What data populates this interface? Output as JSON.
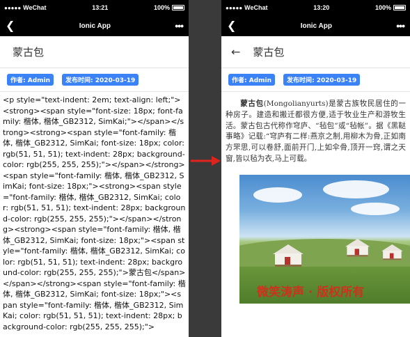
{
  "status": {
    "carrier": "WeChat",
    "battery": "100%",
    "time_left": "13:21",
    "time_right": "13:20"
  },
  "nav": {
    "title": "Ionic App",
    "more": "•••"
  },
  "header": {
    "title": "蒙古包"
  },
  "meta": {
    "author": "作者: Admin",
    "date": "发布时间: 2020-03-19"
  },
  "raw_html": "<p style=\"text-indent: 2em; text-align: left;\"><strong><span style=\"font-size: 18px; font-family: 楷体, 楷体_GB2312, SimKai;\"></span></strong><strong><span style=\"font-family: 楷体, 楷体_GB2312, SimKai; font-size: 18px; color: rgb(51, 51, 51); text-indent: 28px; background-color: rgb(255, 255, 255);\"></span></strong><span style=\"font-family: 楷体, 楷体_GB2312, SimKai; font-size: 18px;\"><strong><span style=\"font-family: 楷体, 楷体_GB2312, SimKai; color: rgb(51, 51, 51); text-indent: 28px; background-color: rgb(255, 255, 255);\"></span></strong><strong><span style=\"font-family: 楷体, 楷体_GB2312, SimKai; font-size: 18px;\"><span style=\"font-family: 楷体, 楷体_GB2312, SimKai; color: rgb(51, 51, 51); text-indent: 28px; background-color: rgb(255, 255, 255);\">蒙古包</span></span></strong><span style=\"font-family: 楷体, 楷体_GB2312, SimKai; font-size: 18px;\"><span style=\"font-family: 楷体, 楷体_GB2312, SimKai; color: rgb(51, 51, 51); text-indent: 28px; background-color: rgb(255, 255, 255);\">",
  "article": {
    "bold": "蒙古包",
    "body": "(Mongolianyurts)是蒙古族牧民居住的一种房子。建造和搬迁都很方便,适于牧业生产和游牧生活。蒙古包古代称作穹庐、“毡包”或“毡帐”。据《黑鞑事略》记载:“穹庐有二样:燕京之制,用柳木为骨,正如南方罘思,可以卷舒,面前开门,上如伞骨,顶开一窍,谓之天窗,皆以毡为衣,马上可载。"
  },
  "image": {
    "watermark": "微笑涛声 · 版权所有"
  }
}
